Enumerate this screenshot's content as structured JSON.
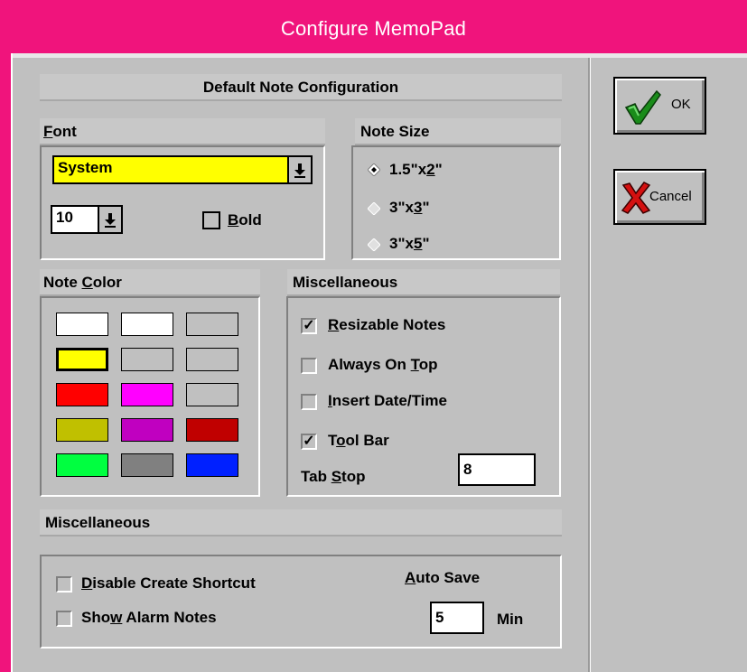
{
  "window": {
    "title": "Configure MemoPad"
  },
  "header": {
    "default_config": "Default Note Configuration"
  },
  "font_group": {
    "label": "Font",
    "font_value": "System",
    "size_value": "10",
    "bold_label": "Bold",
    "bold_checked": false
  },
  "note_size": {
    "label": "Note Size",
    "options": [
      {
        "label": "1.5\"x2\"",
        "selected": true
      },
      {
        "label": "3\"x3\"",
        "selected": false
      },
      {
        "label": "3\"x5\"",
        "selected": false
      }
    ]
  },
  "note_color": {
    "label": "Note Color",
    "swatches": [
      "#ffffff",
      "#ffffff",
      "#c0c0c0",
      "#ffff00",
      "#c0c0c0",
      "#c0c0c0",
      "#ff0000",
      "#ff00ff",
      "#c0c0c0",
      "#c0c000",
      "#c000c0",
      "#c00000",
      "#00ff40",
      "#808080",
      "#0020ff"
    ],
    "selected_index": 3
  },
  "misc_note": {
    "label": "Miscellaneous",
    "options": [
      {
        "label": "Resizable Notes",
        "checked": true
      },
      {
        "label": "Always On Top",
        "checked": false
      },
      {
        "label": "Insert Date/Time",
        "checked": false
      },
      {
        "label": "Tool Bar",
        "checked": true
      }
    ],
    "tab_stop_label": "Tab Stop",
    "tab_stop_value": "8"
  },
  "misc_global": {
    "label": "Miscellaneous",
    "disable_shortcut_label": "Disable Create Shortcut",
    "show_alarm_label": "Show Alarm Notes",
    "auto_save_label": "Auto Save",
    "auto_save_value": "5",
    "auto_save_unit": "Min"
  },
  "buttons": {
    "ok": "OK",
    "cancel": "Cancel"
  },
  "icons": {
    "ok": "checkmark-icon",
    "cancel": "x-mark-icon",
    "dropdown": "down-arrow-icon"
  }
}
